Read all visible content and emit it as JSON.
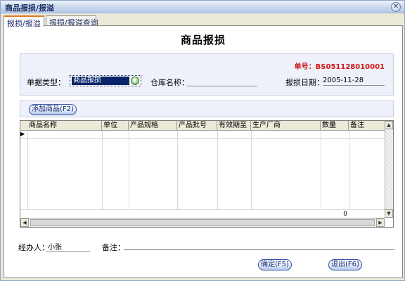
{
  "window": {
    "title": "商品报损/报溢",
    "close_icon": "close-icon"
  },
  "tabs": [
    {
      "label": "报损/报溢",
      "active": true
    },
    {
      "label": "报损/报溢查询",
      "active": false
    }
  ],
  "form": {
    "title": "商品报损",
    "doc_no": "单号：BS051128010001",
    "type_label": "单据类型：",
    "type_value": "商品报损",
    "warehouse_label": "仓库名称：",
    "warehouse_value": "",
    "date_label": "报损日期：",
    "date_value": "2005-11-28"
  },
  "toolbar": {
    "add_label": "添加商品(F2)"
  },
  "grid": {
    "columns": [
      "商品名称",
      "单位",
      "产品规格",
      "产品批号",
      "有效期至",
      "生产厂商",
      "数量",
      "备注"
    ],
    "rows": [],
    "qty_total": "0"
  },
  "footer": {
    "handler_label": "经办人：",
    "handler_value": "小张",
    "remark_label": "备注：",
    "remark_value": "",
    "ok_label": "确定(F5)",
    "exit_label": "退出(F6)"
  }
}
